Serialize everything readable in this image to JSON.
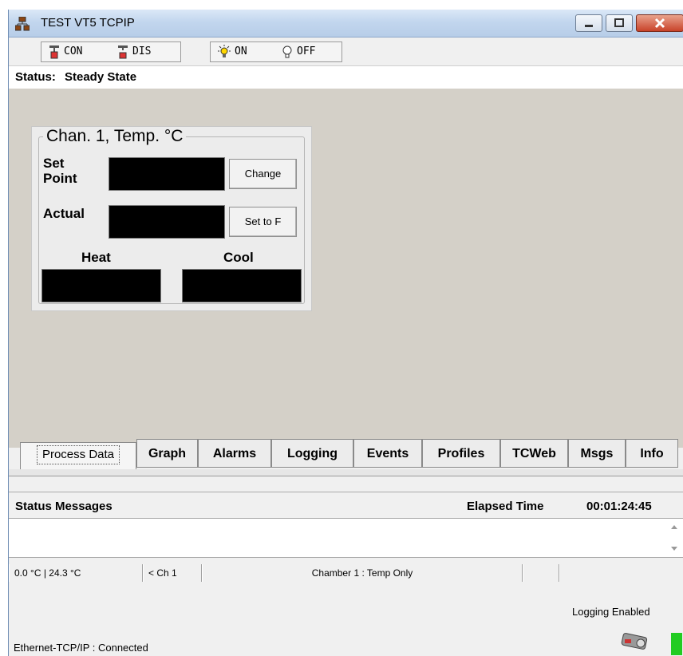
{
  "window": {
    "title": "TEST VT5 TCPIP"
  },
  "toolbar": {
    "con_label": "CON",
    "dis_label": "DIS",
    "on_label": "ON",
    "off_label": "OFF"
  },
  "status": {
    "label": "Status:",
    "value": "Steady State"
  },
  "channel_panel": {
    "title": "Chan. 1, Temp. °C",
    "set_point_label": "Set Point",
    "actual_label": "Actual",
    "change_button": "Change",
    "set_to_f_button": "Set to F",
    "heat_label": "Heat",
    "cool_label": "Cool"
  },
  "tabs": [
    "Process Data",
    "Graph",
    "Alarms",
    "Logging",
    "Events",
    "Profiles",
    "TCWeb",
    "Msgs",
    "Info"
  ],
  "messages": {
    "title": "Status Messages",
    "elapsed_label": "Elapsed Time",
    "elapsed_value": "00:01:24:45"
  },
  "status_bar": {
    "temps": "0.0 °C  |  24.3 °C",
    "channel": "< Ch 1",
    "chamber": "Chamber 1 : Temp Only"
  },
  "footer": {
    "logging": "Logging Enabled",
    "connection": "Ethernet-TCP/IP : Connected"
  },
  "colors": {
    "display_bg": "#000000",
    "panel_bg": "#d4d0c8",
    "indicator": "#22cc22"
  }
}
